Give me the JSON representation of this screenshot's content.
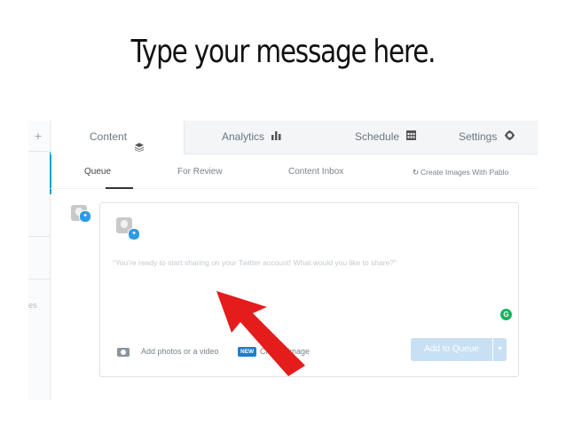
{
  "slide": {
    "title": "Type your message here."
  },
  "sidebar": {
    "add_symbol": "+",
    "cut_label": "es"
  },
  "tabs": [
    {
      "label": "Content",
      "icon": "layers-icon",
      "active": true
    },
    {
      "label": "Analytics",
      "icon": "bar-chart-icon",
      "active": false
    },
    {
      "label": "Schedule",
      "icon": "calendar-icon",
      "active": false
    },
    {
      "label": "Settings",
      "icon": "gear-icon",
      "active": false
    }
  ],
  "subtabs": [
    {
      "label": "Queue",
      "active": true
    },
    {
      "label": "For Review",
      "active": false
    },
    {
      "label": "Content Inbox",
      "active": false
    },
    {
      "label": "Create Images With Pablo",
      "icon": "pablo-icon",
      "active": false
    }
  ],
  "composer": {
    "placeholder": "“You’re ready to start sharing on your Twitter account! What would you like to share?”",
    "attach_label": "Add photos or a video",
    "new_badge": "NEW",
    "create_label": "Cr... an image",
    "add_button": "Add to Queue",
    "grammarly_letter": "G"
  },
  "colors": {
    "accent": "#1a9ed8",
    "twitter": "#2b9be3",
    "arrow": "#e51c1c",
    "button_disabled": "#c7e0f4",
    "grammarly": "#15b45e"
  }
}
